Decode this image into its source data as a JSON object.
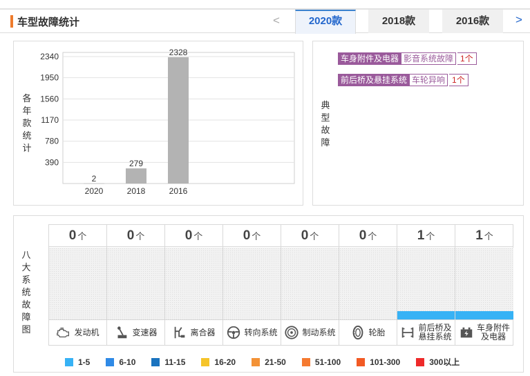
{
  "header": {
    "title": "车型故障统计",
    "prev": "<",
    "next": ">",
    "tabs": [
      {
        "label": "2020款",
        "active": true
      },
      {
        "label": "2018款",
        "active": false
      },
      {
        "label": "2016款",
        "active": false
      }
    ]
  },
  "year_chart": {
    "side_label": [
      "各",
      "年",
      "款",
      "统",
      "计"
    ],
    "yticks": [
      "2340",
      "1950",
      "1560",
      "1170",
      "780",
      "390"
    ],
    "bar_color": "#b3b3b3"
  },
  "chart_data": {
    "type": "bar",
    "categories": [
      "2020",
      "2018",
      "2016"
    ],
    "values": [
      2,
      279,
      2328
    ],
    "ylim": [
      0,
      2340
    ],
    "ylabel": "各年款统计"
  },
  "typical_faults": {
    "side_label": [
      "典",
      "型",
      "故",
      "障"
    ],
    "items": [
      {
        "category": "车身附件及电器",
        "fault": "影音系统故障",
        "count": "1个"
      },
      {
        "category": "前后桥及悬挂系统",
        "fault": "车轮异响",
        "count": "1个"
      }
    ],
    "color": "#9a5a9b"
  },
  "eight_systems": {
    "side_label": [
      "八",
      "大",
      "系",
      "统",
      "故",
      "障",
      "图"
    ],
    "unit": "个",
    "fill_color": "#37b2f5",
    "systems": [
      {
        "name_lines": [
          "发动机"
        ],
        "count": "0",
        "icon": "engine-icon",
        "fill": 0
      },
      {
        "name_lines": [
          "变速器"
        ],
        "count": "0",
        "icon": "gearshift-icon",
        "fill": 0
      },
      {
        "name_lines": [
          "离合器"
        ],
        "count": "0",
        "icon": "clutch-icon",
        "fill": 0
      },
      {
        "name_lines": [
          "转向系统"
        ],
        "count": "0",
        "icon": "steering-wheel-icon",
        "fill": 0
      },
      {
        "name_lines": [
          "制动系统"
        ],
        "count": "0",
        "icon": "brake-disc-icon",
        "fill": 0
      },
      {
        "name_lines": [
          "轮胎"
        ],
        "count": "0",
        "icon": "tire-icon",
        "fill": 0
      },
      {
        "name_lines": [
          "前后桥及",
          "悬挂系统"
        ],
        "count": "1",
        "icon": "suspension-icon",
        "fill": 0.12
      },
      {
        "name_lines": [
          "车身附件",
          "及电器"
        ],
        "count": "1",
        "icon": "battery-icon",
        "fill": 0.12
      }
    ]
  },
  "legend": [
    {
      "label": "1-5",
      "color": "#37b2f5"
    },
    {
      "label": "6-10",
      "color": "#2f8ae6"
    },
    {
      "label": "11-15",
      "color": "#1a73bf"
    },
    {
      "label": "16-20",
      "color": "#f5c42a"
    },
    {
      "label": "21-50",
      "color": "#f39236"
    },
    {
      "label": "51-100",
      "color": "#f57a30"
    },
    {
      "label": "101-300",
      "color": "#f25a24"
    },
    {
      "label": "300以上",
      "color": "#ee2a2a"
    }
  ]
}
